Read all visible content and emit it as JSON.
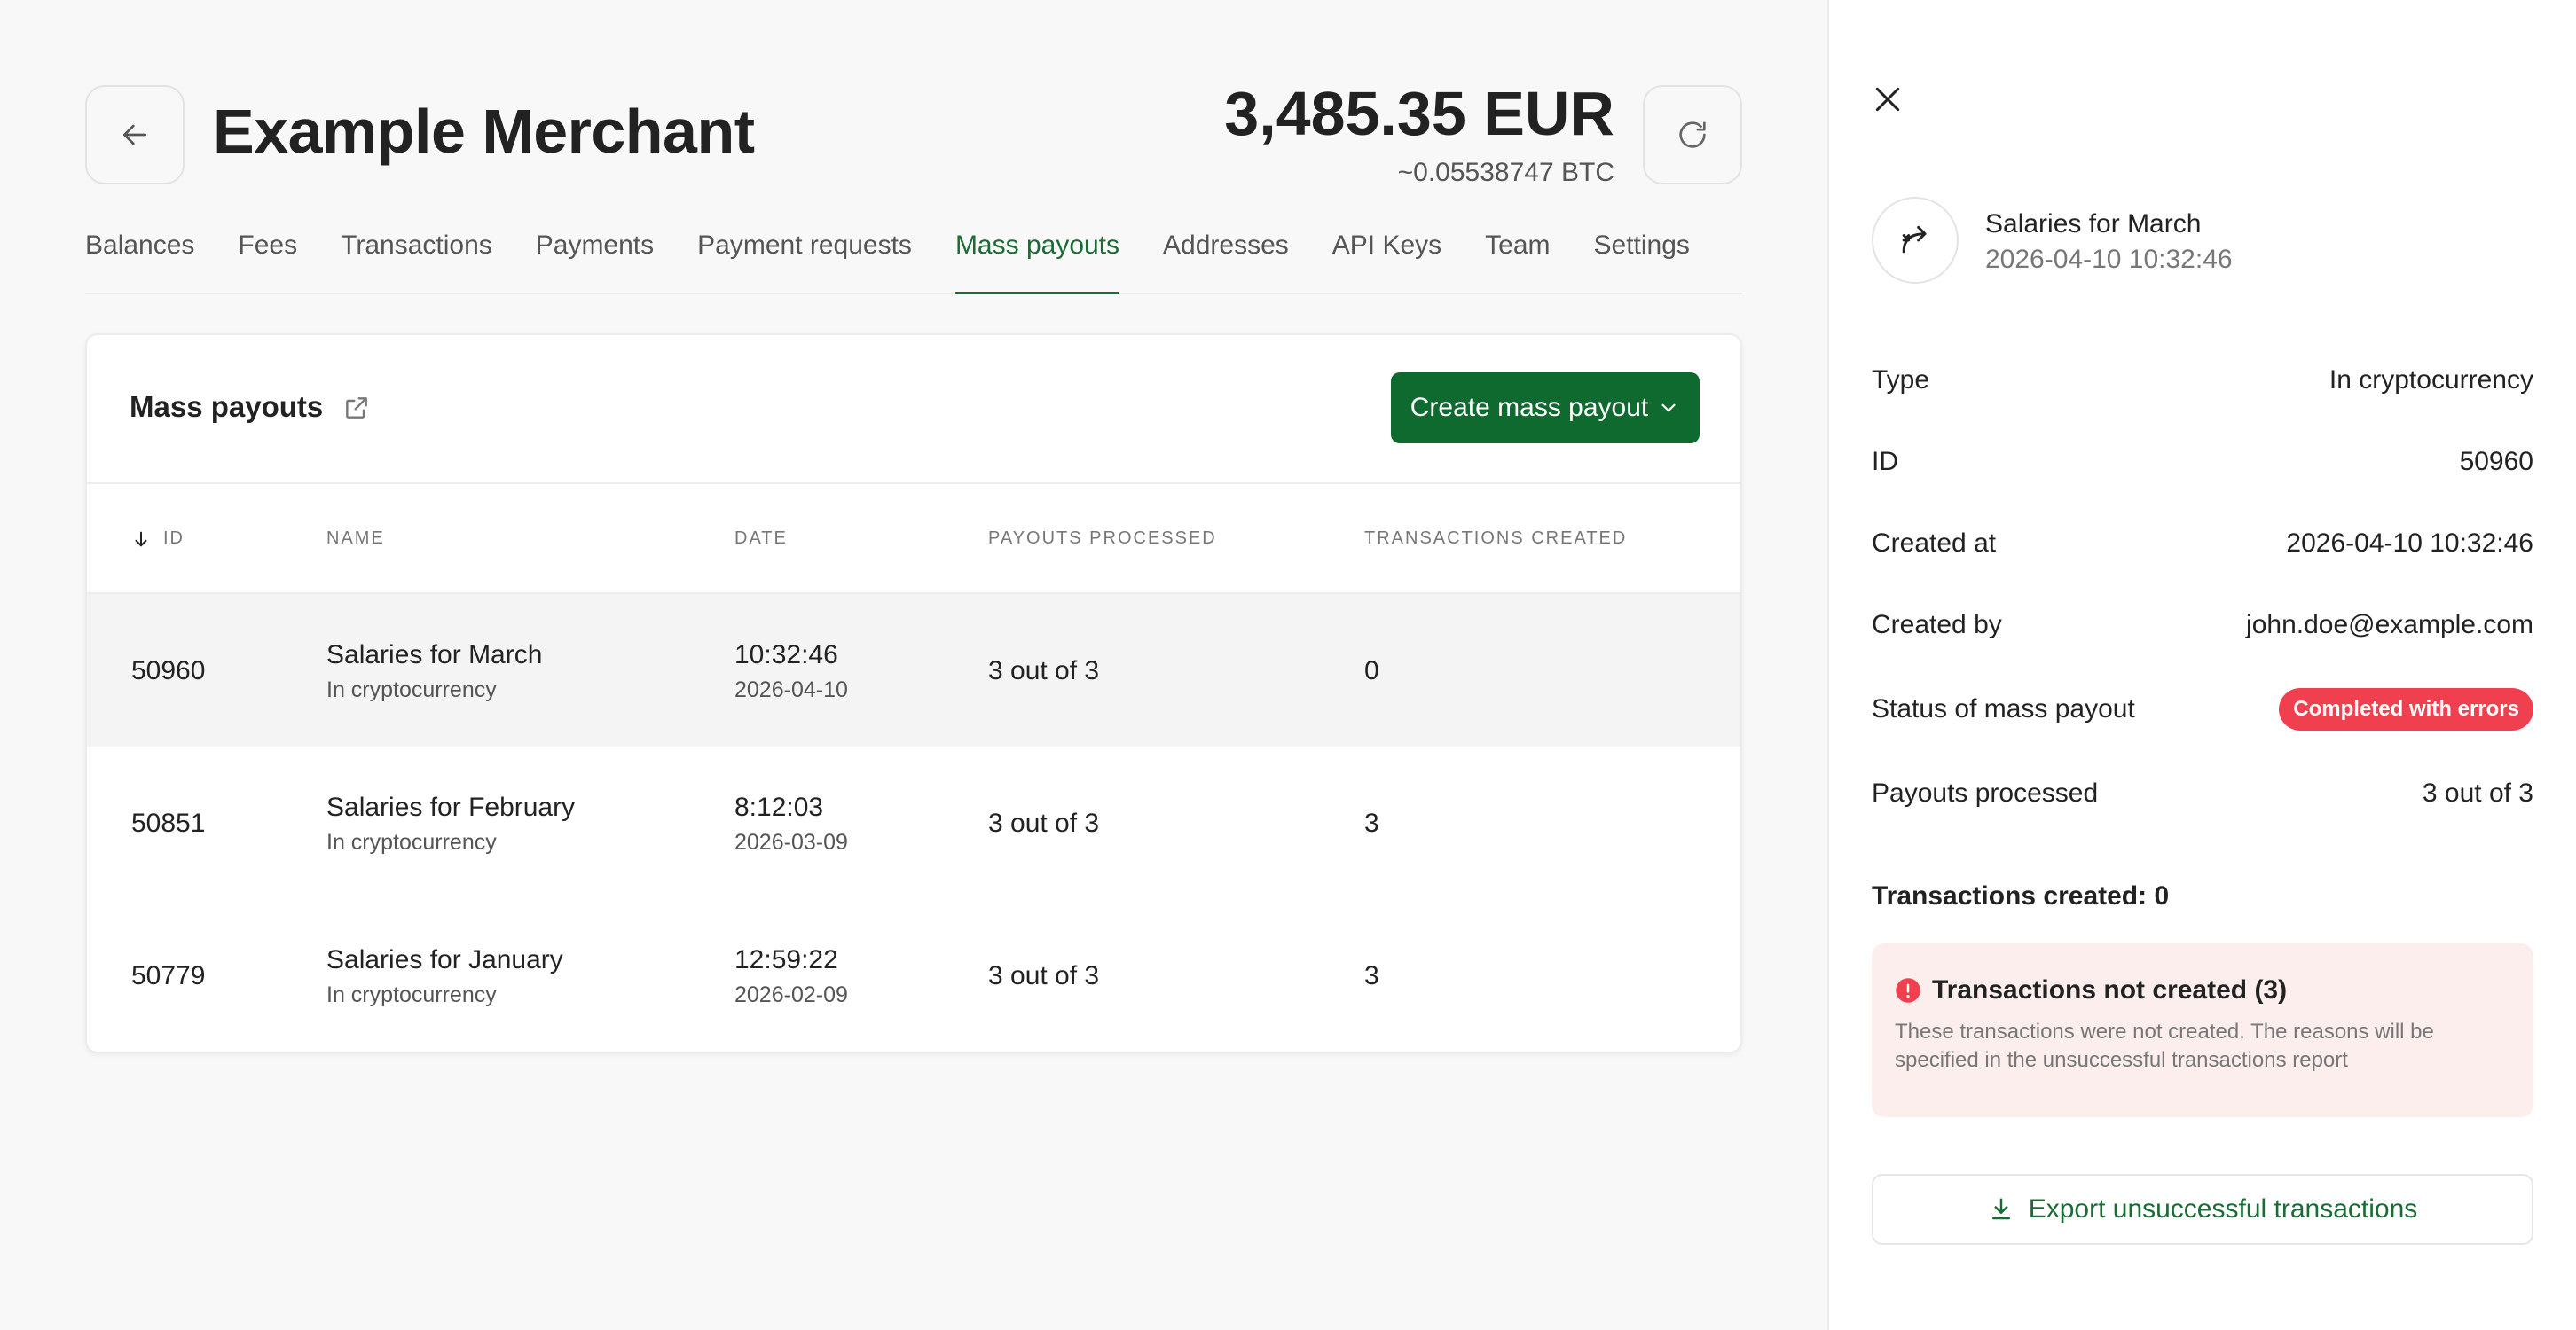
{
  "header": {
    "title": "Example Merchant",
    "balance": "3,485.35 EUR",
    "balance_btc": "~0.05538747 BTC"
  },
  "tabs": [
    {
      "label": "Balances"
    },
    {
      "label": "Fees"
    },
    {
      "label": "Transactions"
    },
    {
      "label": "Payments"
    },
    {
      "label": "Payment requests"
    },
    {
      "label": "Mass payouts",
      "active": true
    },
    {
      "label": "Addresses"
    },
    {
      "label": "API Keys"
    },
    {
      "label": "Team"
    },
    {
      "label": "Settings"
    }
  ],
  "card": {
    "title": "Mass payouts",
    "create_label": "Create mass payout"
  },
  "table": {
    "columns": {
      "id": "ID",
      "name": "Name",
      "date": "Date",
      "payouts": "Payouts processed",
      "tx": "Transactions created"
    },
    "rows": [
      {
        "id": "50960",
        "name": "Salaries for March",
        "type": "In cryptocurrency",
        "time": "10:32:46",
        "date": "2026-04-10",
        "payouts": "3 out of 3",
        "tx": "0"
      },
      {
        "id": "50851",
        "name": "Salaries for February",
        "type": "In cryptocurrency",
        "time": "8:12:03",
        "date": "2026-03-09",
        "payouts": "3 out of 3",
        "tx": "3"
      },
      {
        "id": "50779",
        "name": "Salaries for January",
        "type": "In cryptocurrency",
        "time": "12:59:22",
        "date": "2026-02-09",
        "payouts": "3 out of 3",
        "tx": "3"
      }
    ]
  },
  "panel": {
    "name": "Salaries for March",
    "datetime": "2026-04-10 10:32:46",
    "details": [
      {
        "label": "Type",
        "value": "In cryptocurrency"
      },
      {
        "label": "ID",
        "value": "50960"
      },
      {
        "label": "Created at",
        "value": "2026-04-10 10:32:46"
      },
      {
        "label": "Created by",
        "value": "john.doe@example.com"
      },
      {
        "label": "Status of mass payout",
        "value": "Completed with errors"
      },
      {
        "label": "Payouts processed",
        "value": "3 out of 3"
      }
    ],
    "tx_created": "Transactions created: 0",
    "alert_title": "Transactions not created (3)",
    "alert_text": "These transactions were not created. The reasons will be specified in the unsuccessful transactions report",
    "export_label": "Export unsuccessful transactions"
  },
  "colors": {
    "accent": "#0e6a2f",
    "error": "#f0404f",
    "alert_bg": "#fdeeee"
  }
}
